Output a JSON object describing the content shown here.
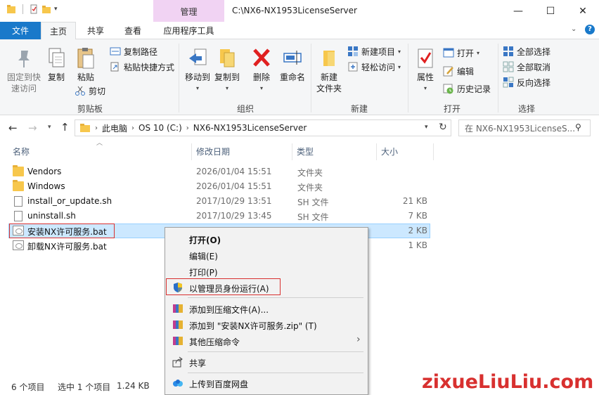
{
  "window": {
    "title": "C:\\NX6-NX1953LicenseServer",
    "manage_label": "管理",
    "minimize": "—",
    "maximize": "☐",
    "close": "✕"
  },
  "tabs": {
    "file": "文件",
    "home": "主页",
    "share": "共享",
    "view": "查看",
    "app_tools": "应用程序工具"
  },
  "ribbon": {
    "pin_line1": "固定到快",
    "pin_line2": "速访问",
    "copy": "复制",
    "paste": "粘贴",
    "copy_path": "复制路径",
    "paste_shortcut": "粘贴快捷方式",
    "cut": "剪切",
    "clipboard_group": "剪贴板",
    "move_to": "移动到",
    "copy_to": "复制到",
    "delete": "删除",
    "rename": "重命名",
    "organize_group": "组织",
    "new_folder_line1": "新建",
    "new_folder_line2": "文件夹",
    "new_item": "新建项目",
    "easy_access": "轻松访问",
    "new_group": "新建",
    "properties": "属性",
    "open": "打开",
    "edit": "编辑",
    "history": "历史记录",
    "open_group": "打开",
    "select_all": "全部选择",
    "select_none": "全部取消",
    "invert_selection": "反向选择",
    "select_group": "选择"
  },
  "address": {
    "crumbs": [
      "此电脑",
      "OS 10 (C:)",
      "NX6-NX1953LicenseServer"
    ],
    "search_placeholder": "在 NX6-NX1953LicenseS..."
  },
  "columns": {
    "name": "名称",
    "date": "修改日期",
    "type": "类型",
    "size": "大小"
  },
  "files": [
    {
      "name": "Vendors",
      "date": "2026/01/04 15:51",
      "type": "文件夹",
      "size": ""
    },
    {
      "name": "Windows",
      "date": "2026/01/04 15:51",
      "type": "文件夹",
      "size": ""
    },
    {
      "name": "install_or_update.sh",
      "date": "2017/10/29 13:51",
      "type": "SH 文件",
      "size": "21 KB"
    },
    {
      "name": "uninstall.sh",
      "date": "2017/10/29 13:45",
      "type": "SH 文件",
      "size": "7 KB"
    },
    {
      "name": "安装NX许可服务.bat",
      "date": "",
      "type": "",
      "size": "2 KB"
    },
    {
      "name": "卸载NX许可服务.bat",
      "date": "",
      "type": "",
      "size": "1 KB"
    }
  ],
  "context_menu": {
    "open": "打开(O)",
    "edit": "编辑(E)",
    "print": "打印(P)",
    "run_as_admin": "以管理员身份运行(A)",
    "add_to_archive": "添加到压缩文件(A)...",
    "add_to_zip": "添加到 \"安装NX许可服务.zip\" (T)",
    "other_compress": "其他压缩命令",
    "share": "共享",
    "upload_baidu": "上传到百度网盘"
  },
  "status": {
    "count": "6 个项目",
    "selected": "选中 1 个项目",
    "size": "1.24 KB"
  },
  "watermark": "zixueLiuLiu.com",
  "colors": {
    "accent": "#1979ca",
    "selection": "#cce8ff",
    "highlight_box": "#d8302f",
    "manage_tab": "#f1d3f3"
  }
}
